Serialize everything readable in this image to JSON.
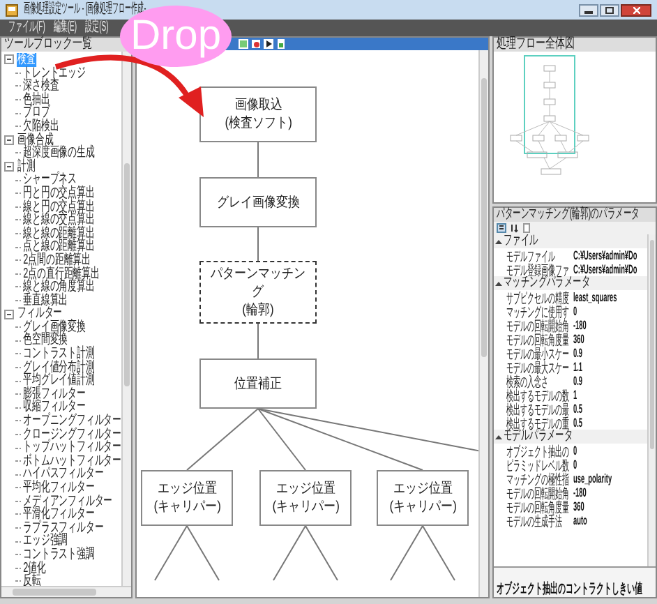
{
  "window": {
    "title": "画像処理設定ツール - [画像処理フロー作成-"
  },
  "menu": [
    "ファイル(F)",
    "編集(E)",
    "設定(S)"
  ],
  "tool_panel": {
    "title": "ツールブロック一覧",
    "tree": [
      {
        "label": "検査",
        "selected": true,
        "expanded": true,
        "children": [
          {
            "label": "トレンドエッジ",
            "selected": false
          },
          {
            "label": "深さ検査",
            "selected": false
          },
          {
            "label": "色抽出",
            "selected": false
          },
          {
            "label": "ブロブ",
            "selected": false
          },
          {
            "label": "欠陥検出",
            "selected": false
          }
        ]
      },
      {
        "label": "画像合成",
        "selected": false,
        "expanded": true,
        "children": [
          {
            "label": "超深度画像の生成",
            "selected": false
          }
        ]
      },
      {
        "label": "計測",
        "selected": false,
        "expanded": true,
        "children": [
          {
            "label": "シャープネス",
            "selected": false
          },
          {
            "label": "円と円の交点算出",
            "selected": false
          },
          {
            "label": "線と円の交点算出",
            "selected": false
          },
          {
            "label": "線と線の交点算出",
            "selected": false
          },
          {
            "label": "線と線の距離算出",
            "selected": false
          },
          {
            "label": "点と線の距離算出",
            "selected": false
          },
          {
            "label": "2点間の距離算出",
            "selected": false
          },
          {
            "label": "2点の直行距離算出",
            "selected": false
          },
          {
            "label": "線と線の角度算出",
            "selected": false
          },
          {
            "label": "垂直線算出",
            "selected": false
          }
        ]
      },
      {
        "label": "フィルター",
        "selected": false,
        "expanded": true,
        "children": [
          {
            "label": "グレイ画像変換",
            "selected": false
          },
          {
            "label": "色空間変換",
            "selected": false
          },
          {
            "label": "コントラスト計測",
            "selected": false
          },
          {
            "label": "グレイ値分布計測",
            "selected": false
          },
          {
            "label": "平均グレイ値計測",
            "selected": false
          },
          {
            "label": "膨張フィルター",
            "selected": false
          },
          {
            "label": "収縮フィルター",
            "selected": false
          },
          {
            "label": "オープニングフィルター",
            "selected": false
          },
          {
            "label": "クロージングフィルター",
            "selected": false
          },
          {
            "label": "トップハットフィルター",
            "selected": false
          },
          {
            "label": "ボトムハットフィルター",
            "selected": false
          },
          {
            "label": "ハイパスフィルター",
            "selected": false
          },
          {
            "label": "平均化フィルター",
            "selected": false
          },
          {
            "label": "メディアンフィルター",
            "selected": false
          },
          {
            "label": "平滑化フィルター",
            "selected": false
          },
          {
            "label": "ラプラスフィルター",
            "selected": false
          },
          {
            "label": "エッジ強調",
            "selected": false
          },
          {
            "label": "コントラスト強調",
            "selected": false
          },
          {
            "label": "2値化",
            "selected": false
          },
          {
            "label": "反転",
            "selected": false
          }
        ]
      }
    ]
  },
  "flow": {
    "steps": [
      {
        "label": "画像取込\n(検査ソフト)",
        "selected": false
      },
      {
        "label": "グレイ画像変換",
        "selected": false
      },
      {
        "label": "パターンマッチング\n(輪郭)",
        "selected": true
      },
      {
        "label": "位置補正",
        "selected": false
      }
    ],
    "branches": [
      {
        "label": "エッジ位置\n(キャリパー)",
        "selected": false
      },
      {
        "label": "エッジ位置\n(キャリパー)",
        "selected": false
      },
      {
        "label": "エッジ位置\n(キャリパー)",
        "selected": false
      }
    ]
  },
  "overview": {
    "title": "処理フロー全体図"
  },
  "parameters": {
    "title": "パターンマッチング(輪郭)のパラメータ",
    "groups": [
      {
        "name": "ファイル",
        "expanded": true,
        "rows": [
          {
            "name": "モデルファイル",
            "value": "C:¥Users¥admin¥Do"
          },
          {
            "name": "モデル登録画像ファ",
            "value": "C:¥Users¥admin¥Do"
          }
        ]
      },
      {
        "name": "マッチングパラメータ",
        "expanded": true,
        "rows": [
          {
            "name": "サブピクセルの精度",
            "value": "least_squares"
          },
          {
            "name": "マッチングに使用す",
            "value": "0"
          },
          {
            "name": "モデルの回転開始角",
            "value": "-180"
          },
          {
            "name": "モデルの回転角度量",
            "value": "360"
          },
          {
            "name": "モデルの最小スケー",
            "value": "0.9"
          },
          {
            "name": "モデルの最大スケー",
            "value": "1.1"
          },
          {
            "name": "検索の入念さ",
            "value": "0.9"
          },
          {
            "name": "検出するモデルの数",
            "value": "1"
          },
          {
            "name": "検出するモデルの最",
            "value": "0.5"
          },
          {
            "name": "検出するモデルの重",
            "value": "0.5"
          }
        ]
      },
      {
        "name": "モデルパラメータ",
        "expanded": true,
        "rows": [
          {
            "name": "オブジェクト抽出の",
            "value": "0"
          },
          {
            "name": "ピラミッドレベル数",
            "value": "0"
          },
          {
            "name": "マッチングの極性指",
            "value": "use_polarity"
          },
          {
            "name": "モデルの回転開始角",
            "value": "-180"
          },
          {
            "name": "モデルの回転角度量",
            "value": "360"
          },
          {
            "name": "モデルの生成手法",
            "value": "auto"
          }
        ]
      }
    ],
    "description": "オブジェクト抽出のコントラクトしきい値"
  },
  "annotation": {
    "label": "Drop"
  }
}
